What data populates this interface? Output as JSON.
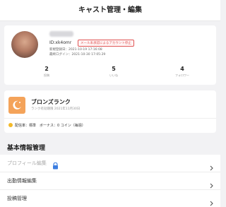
{
  "header": {
    "title": "キャスト管理・編集"
  },
  "profile": {
    "id_text": "ID:xk4omr",
    "restriction_badge": "メール未承認によるアカウント停止",
    "registered": "新規登録日：2021-10-19 17:16:08",
    "last_login": "最終ログイン：2021-10-30 17:05:29",
    "stats": [
      {
        "value": "2",
        "label": "投稿"
      },
      {
        "value": "5",
        "label": "いいね"
      },
      {
        "value": "4",
        "label": "フォロワー"
      }
    ]
  },
  "rank": {
    "title": "ブロンズランク",
    "date": "ランク有効期限 2021年11月30日",
    "bonus": "配信率：標準　ボーナス：0 コイン（毎週）"
  },
  "section": {
    "title": "基本情報管理"
  },
  "menu": [
    {
      "label": "プロフィール編集",
      "disabled": true,
      "locked": true
    },
    {
      "label": "出勤情報編集",
      "disabled": false
    },
    {
      "label": "投稿管理",
      "disabled": false
    }
  ],
  "colors": {
    "badge_red": "#e05555",
    "rank_orange": "#f4a35a",
    "coin_yellow": "#f3b928",
    "lock_blue": "#3b7de0"
  }
}
